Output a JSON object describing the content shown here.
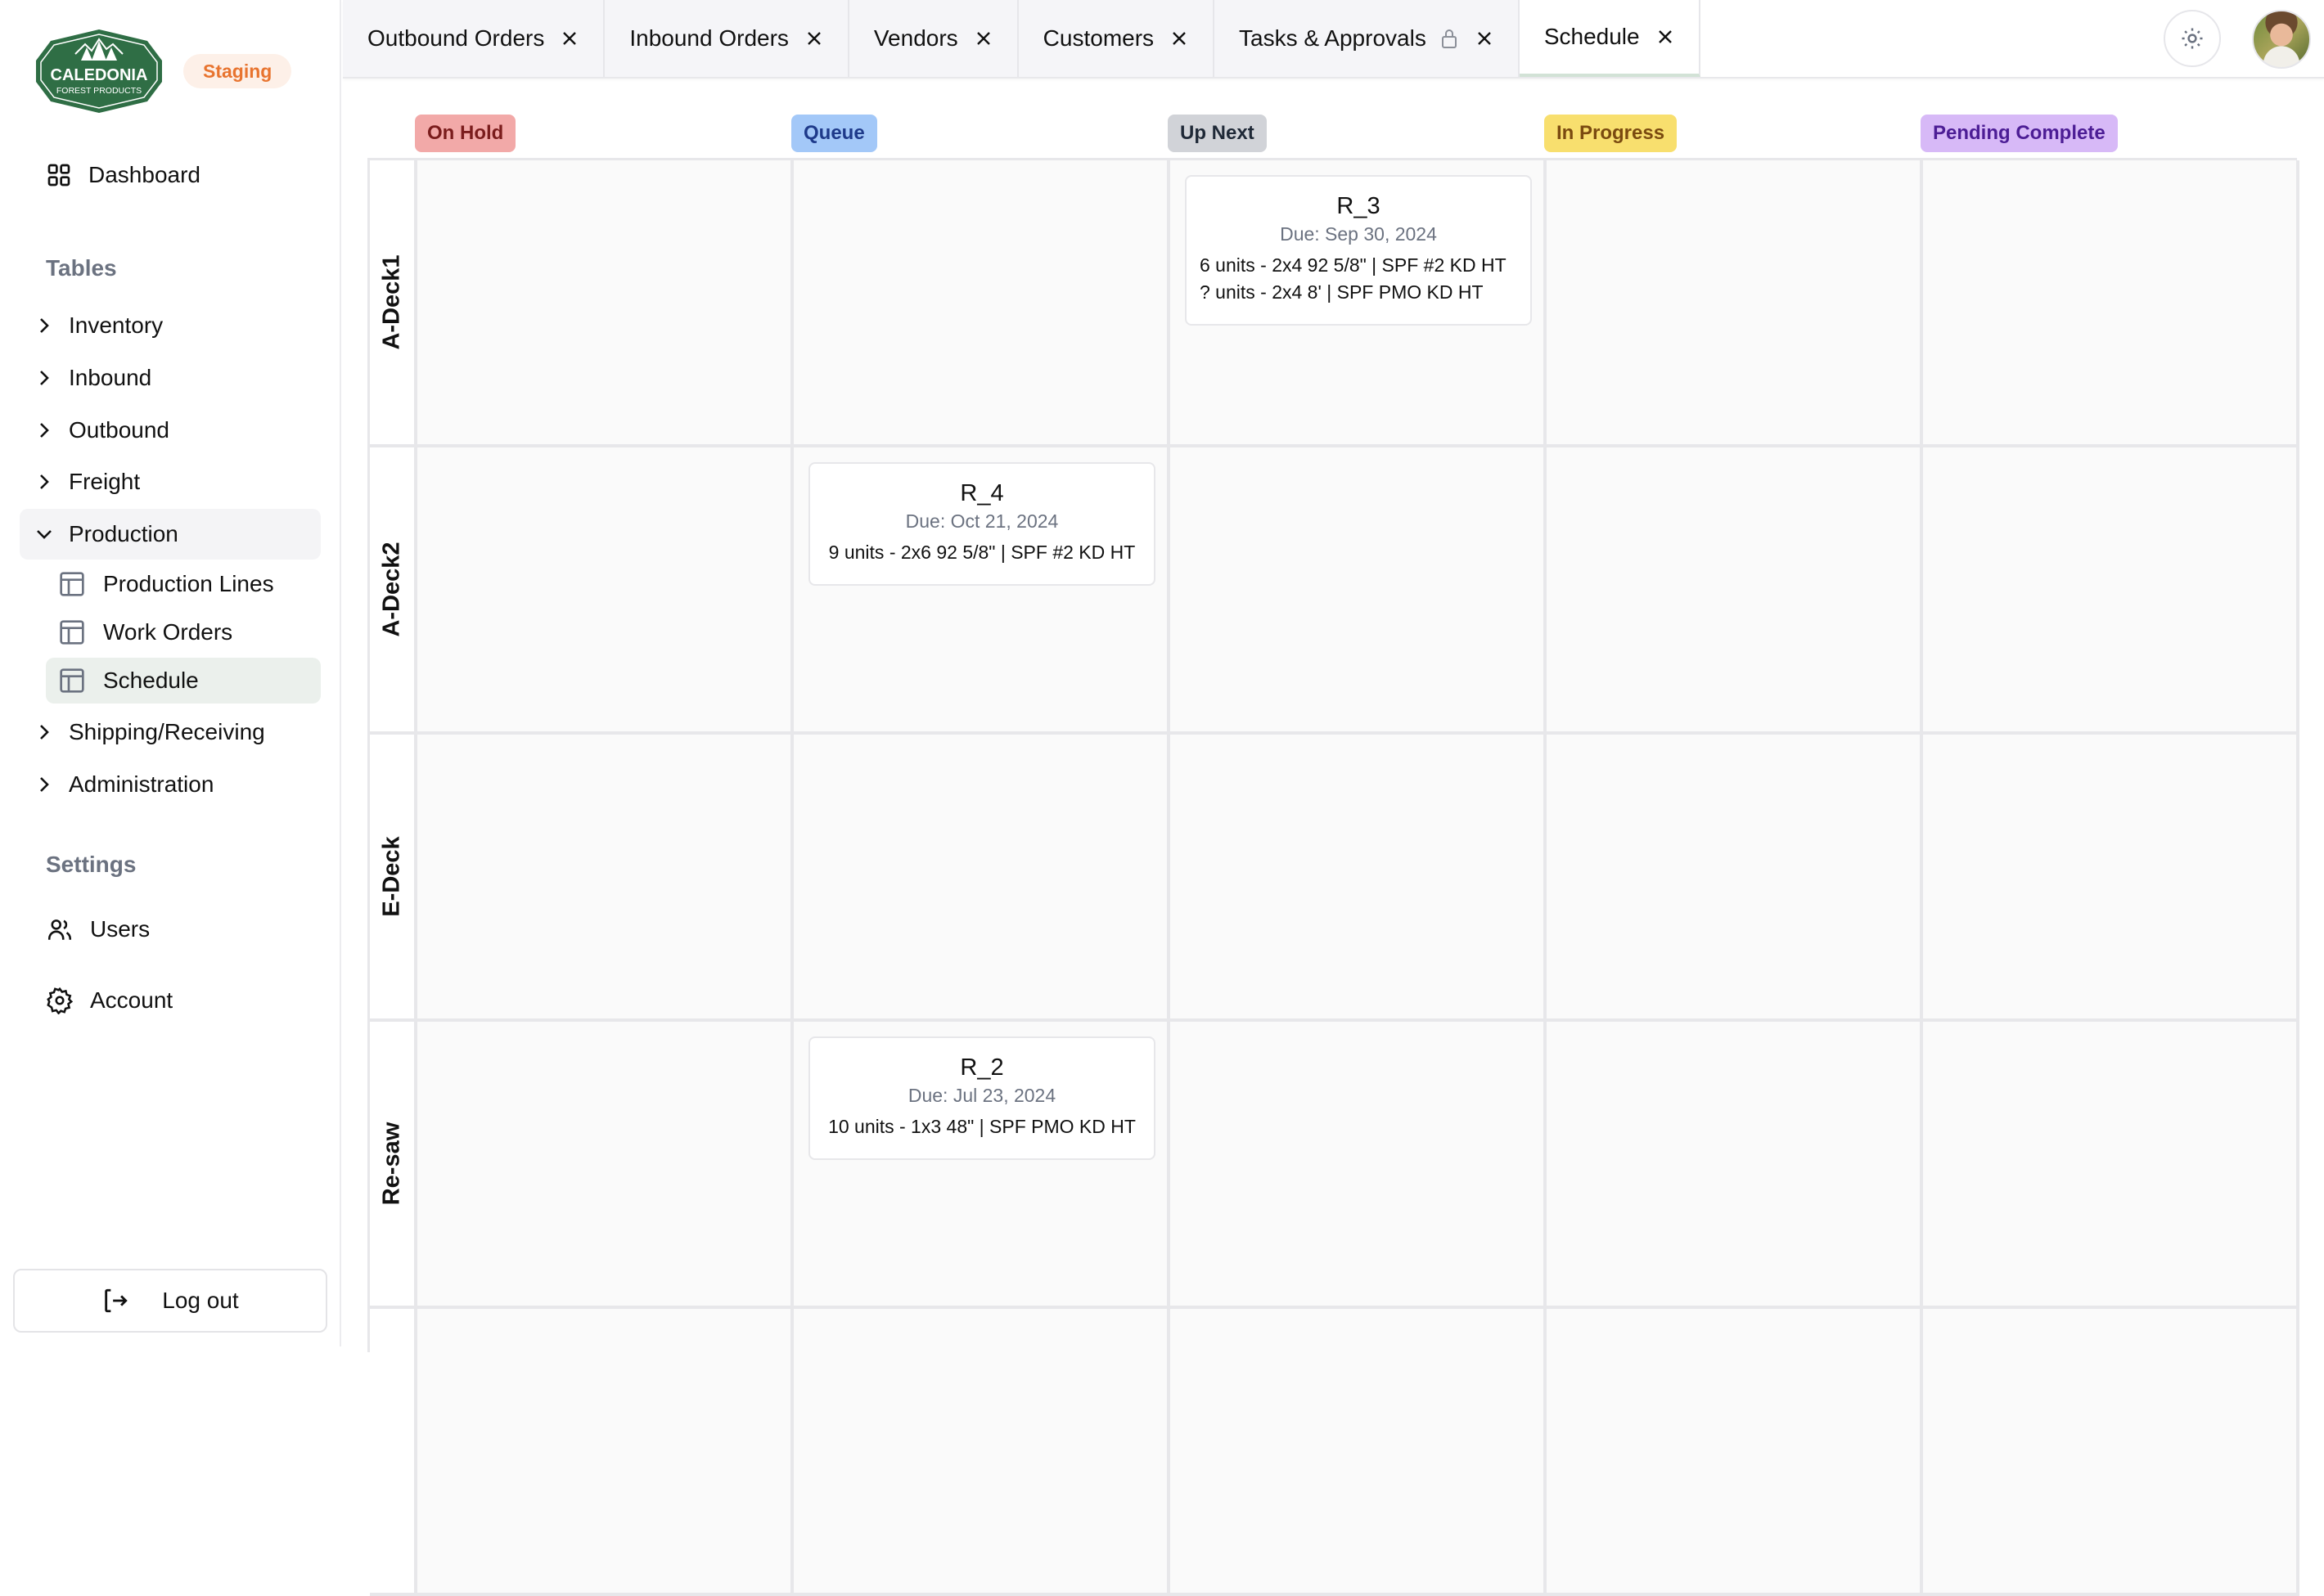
{
  "app": {
    "logo": {
      "line1": "CALEDONIA",
      "line2": "FOREST PRODUCTS"
    },
    "environment": "Staging"
  },
  "sidebar": {
    "dashboard": {
      "label": "Dashboard",
      "icon": "dashboard-grid-icon"
    },
    "tables_heading": "Tables",
    "tables": [
      {
        "label": "Inventory",
        "expanded": false
      },
      {
        "label": "Inbound",
        "expanded": false
      },
      {
        "label": "Outbound",
        "expanded": false
      },
      {
        "label": "Freight",
        "expanded": false
      },
      {
        "label": "Production",
        "expanded": true,
        "children": [
          {
            "label": "Production Lines",
            "active": false
          },
          {
            "label": "Work Orders",
            "active": false
          },
          {
            "label": "Schedule",
            "active": true
          }
        ]
      },
      {
        "label": "Shipping/Receiving",
        "expanded": false
      },
      {
        "label": "Administration",
        "expanded": false
      }
    ],
    "settings_heading": "Settings",
    "settings": [
      {
        "label": "Users",
        "icon": "users-icon"
      },
      {
        "label": "Account",
        "icon": "gear-icon"
      }
    ],
    "logout_label": "Log out"
  },
  "tabs": [
    {
      "label": "Outbound Orders",
      "locked": false,
      "active": false
    },
    {
      "label": "Inbound Orders",
      "locked": false,
      "active": false
    },
    {
      "label": "Vendors",
      "locked": false,
      "active": false
    },
    {
      "label": "Customers",
      "locked": false,
      "active": false
    },
    {
      "label": "Tasks & Approvals",
      "locked": true,
      "active": false
    },
    {
      "label": "Schedule",
      "locked": false,
      "active": true
    }
  ],
  "header": {
    "theme_toggle_icon": "sun-icon",
    "avatar": "user-avatar"
  },
  "board": {
    "columns": [
      {
        "label": "On Hold",
        "bg": "#f2a9a8",
        "fg": "#7a1c1c"
      },
      {
        "label": "Queue",
        "bg": "#a3c8f8",
        "fg": "#1e3a8a"
      },
      {
        "label": "Up Next",
        "bg": "#d1d3d8",
        "fg": "#1f2937"
      },
      {
        "label": "In Progress",
        "bg": "#f8df6e",
        "fg": "#7a4a10"
      },
      {
        "label": "Pending Complete",
        "bg": "#d7b9f7",
        "fg": "#4c1d95"
      }
    ],
    "rows": [
      {
        "label": "A-Deck1"
      },
      {
        "label": "A-Deck2"
      },
      {
        "label": "E-Deck"
      },
      {
        "label": "Re-saw"
      },
      {
        "label": ""
      }
    ],
    "cards": [
      {
        "row": 0,
        "col": 2,
        "title": "R_3",
        "due": "Due: Sep 30, 2024",
        "lines": [
          "6 units - 2x4 92 5/8\" | SPF #2 KD HT",
          "? units - 2x4 8' | SPF PMO KD HT"
        ]
      },
      {
        "row": 1,
        "col": 1,
        "title": "R_4",
        "due": "Due: Oct 21, 2024",
        "lines": [
          "9 units - 2x6 92 5/8\" | SPF #2 KD HT"
        ]
      },
      {
        "row": 3,
        "col": 1,
        "title": "R_2",
        "due": "Due: Jul 23, 2024",
        "lines": [
          "10 units - 1x3 48\" | SPF PMO KD HT"
        ]
      }
    ]
  },
  "colors": {
    "brand_green": "#2f6e45",
    "staging_orange": "#e8742f",
    "active_tab_indicator": "#d2e2d6"
  }
}
